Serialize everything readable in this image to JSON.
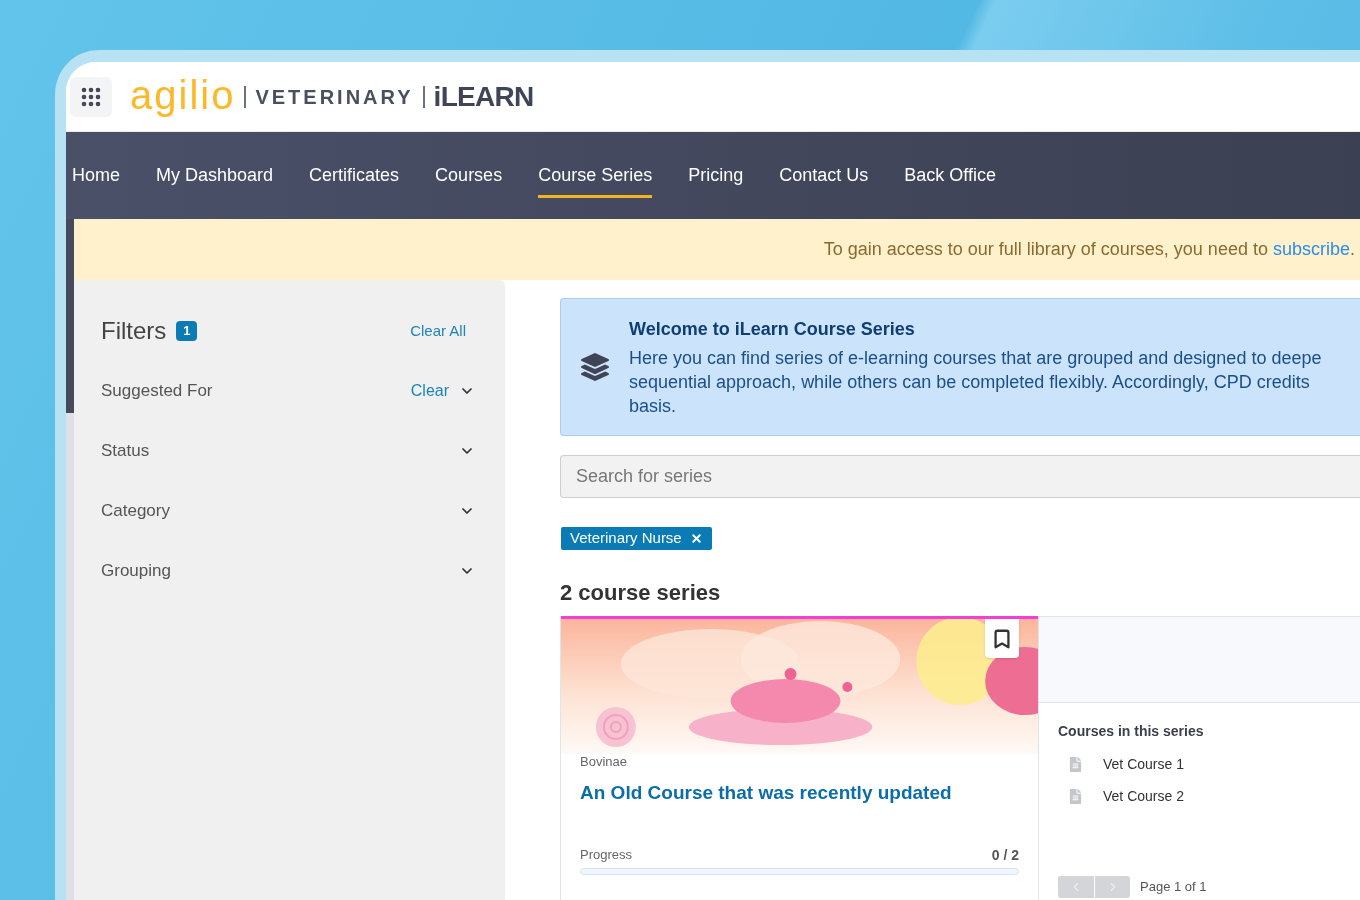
{
  "header": {
    "logo": {
      "brand": "agilio",
      "product": "VETERINARY",
      "platform": "iLEARN"
    }
  },
  "nav": {
    "items": [
      {
        "label": "Home",
        "selected": false
      },
      {
        "label": "My Dashboard",
        "selected": false
      },
      {
        "label": "Certificates",
        "selected": false
      },
      {
        "label": "Courses",
        "selected": false
      },
      {
        "label": "Course Series",
        "selected": true
      },
      {
        "label": "Pricing",
        "selected": false
      },
      {
        "label": "Contact Us",
        "selected": false
      },
      {
        "label": "Back Office",
        "selected": false
      }
    ]
  },
  "notice": {
    "text": "To gain access to our full library of courses, you need to",
    "link": "subscribe",
    "end": "."
  },
  "filters": {
    "title": "Filters",
    "count": "1",
    "clear_all": "Clear All",
    "groups": [
      {
        "label": "Suggested For",
        "clear": "Clear",
        "expanded": false
      },
      {
        "label": "Status",
        "expanded": false
      },
      {
        "label": "Category",
        "expanded": false
      },
      {
        "label": "Grouping",
        "expanded": false
      }
    ]
  },
  "welcome": {
    "title": "Welcome to iLearn Course Series",
    "lines": [
      "Here you can find series of e-learning courses that are grouped and designed to deepe",
      "sequential approach, while others can be completed flexibly. Accordingly, CPD credits",
      "basis."
    ]
  },
  "search": {
    "placeholder": "Search for series"
  },
  "active_filters": [
    {
      "label": "Veterinary Nurse"
    }
  ],
  "results": {
    "heading": "2 course series",
    "cards": [
      {
        "color": "#f43fd6",
        "category": "Bovinae",
        "title": "An Old Course that was recently updated",
        "bookmarked": false,
        "progress": {
          "label": "Progress",
          "reading": "0 / 2",
          "level": 0
        },
        "courses_heading": "Courses in this series",
        "courses": [
          "Vet Course 1",
          "Vet Course 2"
        ],
        "pagination": {
          "previous": {
            "disabled": true
          },
          "next": {
            "disabled": true
          },
          "text": "Page 1 of 1"
        }
      }
    ]
  }
}
